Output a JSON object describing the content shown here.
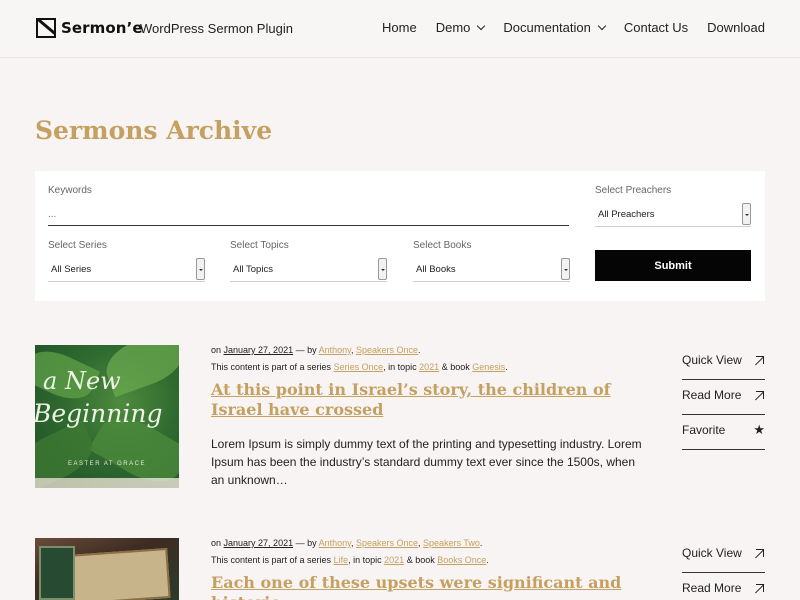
{
  "header": {
    "brand": "Sermon’e",
    "tagline": "WordPress Sermon Plugin",
    "nav": [
      {
        "label": "Home",
        "dropdown": false
      },
      {
        "label": "Demo",
        "dropdown": true
      },
      {
        "label": "Documentation",
        "dropdown": true
      },
      {
        "label": "Contact Us",
        "dropdown": false
      },
      {
        "label": "Download",
        "dropdown": false
      }
    ]
  },
  "page": {
    "title": "Sermons Archive"
  },
  "filter": {
    "keywords_label": "Keywords",
    "keywords_placeholder": "...",
    "preachers_label": "Select Preachers",
    "preachers_value": "All Preachers",
    "series_label": "Select Series",
    "series_value": "All Series",
    "topics_label": "Select Topics",
    "topics_value": "All Topics",
    "books_label": "Select Books",
    "books_value": "All Books",
    "submit_label": "Submit"
  },
  "sermons": [
    {
      "image_text_script_1": "a New",
      "image_text_script_2": "Beginning",
      "image_text_small": "EASTER AT GRACE",
      "meta_on": "on",
      "date": "January 27, 2021",
      "meta_by": " — by ",
      "authors": [
        "Anthony",
        "Speakers Once"
      ],
      "meta_series_prefix": "This content is part of a series",
      "series": "Series Once",
      "meta_topic_prefix": ", in topic",
      "topic": "2021",
      "meta_book_prefix": "& book",
      "book": "Genesis",
      "title": "At this point in Israel’s story, the children of Israel have crossed",
      "excerpt": "Lorem Ipsum is simply dummy text of the printing and typesetting industry. Lorem Ipsum has been the industry’s standard dummy text ever since the 1500s, when an unknown…",
      "actions": {
        "quick_view": "Quick View",
        "read_more": "Read More",
        "favorite": "Favorite"
      }
    },
    {
      "meta_on": "on",
      "date": "January 27, 2021",
      "meta_by": " — by ",
      "authors": [
        "Anthony",
        "Speakers Once",
        "Speakers Two"
      ],
      "meta_series_prefix": "This content is part of a series",
      "series": "Life",
      "meta_topic_prefix": ", in topic",
      "topic": "2021",
      "meta_book_prefix": "& book",
      "book": "Books Once",
      "title": "Each one of these upsets were significant and historic",
      "actions": {
        "quick_view": "Quick View",
        "read_more": "Read More"
      }
    }
  ],
  "colors": {
    "accent": "#c4a061",
    "background": "#f7f4f3",
    "button": "#050505"
  }
}
